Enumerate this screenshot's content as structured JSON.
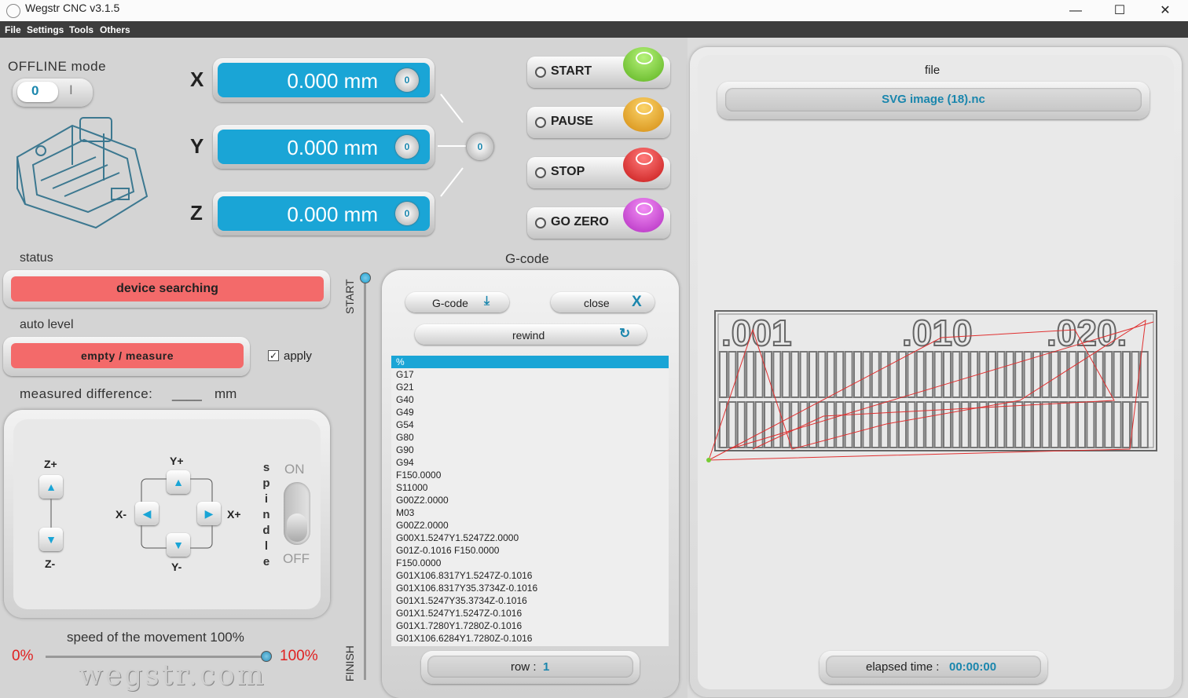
{
  "window": {
    "title": "Wegstr CNC  v3.1.5",
    "controls": {
      "minimize": "—",
      "maximize": "☐",
      "close": "✕"
    }
  },
  "menu": [
    "File",
    "Settings",
    "Tools",
    "Others"
  ],
  "mode": {
    "label": "OFFLINE mode",
    "toggle_off": "0",
    "toggle_on": "I"
  },
  "axes": [
    {
      "name": "X",
      "value": "0.000 mm"
    },
    {
      "name": "Y",
      "value": "0.000 mm"
    },
    {
      "name": "Z",
      "value": "0.000 mm"
    }
  ],
  "zero_knob": "0",
  "controls": [
    {
      "label": "START",
      "color": "#6fce2e",
      "icon": "play-icon"
    },
    {
      "label": "PAUSE",
      "color": "#e8a51b",
      "icon": "pause-icon"
    },
    {
      "label": "STOP",
      "color": "#e12b2b",
      "icon": "stop-icon"
    },
    {
      "label": "GO ZERO",
      "color": "#d43ad8",
      "icon": "target-icon"
    }
  ],
  "status": {
    "label": "status",
    "value": "device searching"
  },
  "auto_level": {
    "label": "auto level",
    "button": "empty / measure",
    "apply_label": "apply",
    "apply_checked": true
  },
  "measured": {
    "label": "measured difference:",
    "value": "____",
    "unit": "mm"
  },
  "jog": {
    "z_plus": "Z+",
    "z_minus": "Z-",
    "y_plus": "Y+",
    "y_minus": "Y-",
    "x_plus": "X+",
    "x_minus": "X-",
    "spindle_letters": [
      "s",
      "p",
      "i",
      "n",
      "d",
      "l",
      "e"
    ],
    "spindle_on": "ON",
    "spindle_off": "OFF"
  },
  "speed": {
    "label": "speed of the movement 100%",
    "min": "0%",
    "max": "100%",
    "value_pct": 100
  },
  "watermark": "wegstr.com",
  "progress": {
    "start": "START",
    "finish": "FINISH"
  },
  "gcode": {
    "title": "G-code",
    "load_button": "G-code",
    "close_button": "close",
    "close_glyph": "X",
    "rewind_button": "rewind",
    "lines": [
      "%",
      "G17",
      "G21",
      "G40",
      "G49",
      "G54",
      "G80",
      "G90",
      "G94",
      "F150.0000",
      "S11000",
      "G00Z2.0000",
      "M03",
      "G00Z2.0000",
      "G00X1.5247Y1.5247Z2.0000",
      "G01Z-0.1016 F150.0000",
      "F150.0000",
      "G01X106.8317Y1.5247Z-0.1016",
      "G01X106.8317Y35.3734Z-0.1016",
      "G01X1.5247Y35.3734Z-0.1016",
      "G01X1.5247Y1.5247Z-0.1016",
      "G01X1.7280Y1.7280Z-0.1016",
      "G01X106.6284Y1.7280Z-0.1016"
    ],
    "selected_index": 0,
    "row_label": "row :",
    "row_value": "1"
  },
  "preview": {
    "file_label": "file",
    "file_name": "SVG image (18).nc",
    "labels": [
      ".001",
      ".010",
      ".020."
    ],
    "elapsed_label": "elapsed time :",
    "elapsed_value": "00:00:00"
  },
  "colors": {
    "accent": "#1aa5d6",
    "alert": "#f36a6a",
    "path": "#e03030",
    "origin": "#77cc33"
  }
}
